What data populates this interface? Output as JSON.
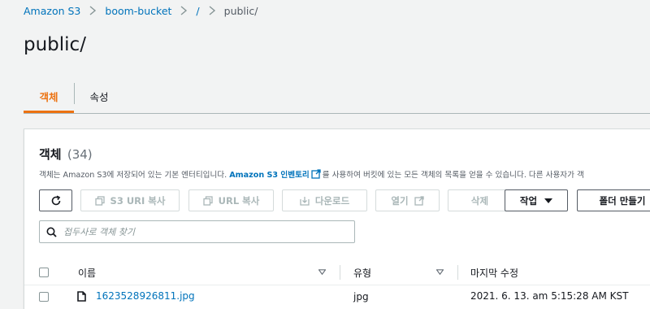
{
  "breadcrumb": {
    "items": [
      "Amazon S3",
      "boom-bucket",
      "/",
      "public/"
    ]
  },
  "page": {
    "title": "public/"
  },
  "tabs": [
    {
      "label": "객체",
      "active": true
    },
    {
      "label": "속성",
      "active": false
    }
  ],
  "objects_panel": {
    "title": "객체",
    "count": "(34)",
    "description_prefix": "객체는 Amazon S3에 저장되어 있는 기본 엔터티입니다.",
    "description_link": "Amazon S3 인벤토리",
    "description_suffix": "를 사용하여 버킷에 있는 모든 객체의 목록을 얻을 수 있습니다. 다른 사용자가 객",
    "toolbar": {
      "refresh_icon": "refresh-icon",
      "copy_s3_uri": "S3 URI 복사",
      "copy_url": "URL 복사",
      "download": "다운로드",
      "open": "열기",
      "delete": "삭제",
      "actions": "작업",
      "create_folder": "폴더 만들기"
    },
    "search": {
      "placeholder": "접두사로 객체 찾기"
    },
    "table": {
      "columns": [
        "이름",
        "유형",
        "마지막 수정"
      ],
      "rows": [
        {
          "name": "1623528926811.jpg",
          "type": "jpg",
          "last_modified": "2021. 6. 13. am 5:15:28 AM KST"
        }
      ]
    }
  },
  "colors": {
    "accent": "#ec7211",
    "link": "#0073bb"
  }
}
